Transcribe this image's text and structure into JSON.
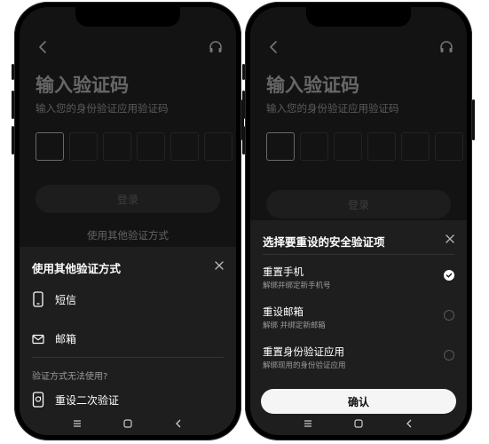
{
  "screen_verify": {
    "title": "输入验证码",
    "subtitle": "输入您的身份验证应用验证码",
    "code_length": 6,
    "login_label": "登录",
    "other_methods_link": "使用其他验证方式",
    "sheet": {
      "title": "使用其他验证方式",
      "options": [
        {
          "label": "短信",
          "icon": "phone-icon"
        },
        {
          "label": "邮箱",
          "icon": "mail-icon"
        }
      ],
      "unavailable_hint": "验证方式无法使用?",
      "reset_label": "重设二次验证",
      "reset_icon": "reset-device-icon"
    }
  },
  "screen_reset": {
    "title": "输入验证码",
    "subtitle": "输入您的身份验证应用验证码",
    "login_label": "登录",
    "sheet": {
      "title": "选择要重设的安全验证项",
      "options": [
        {
          "title": "重置手机",
          "desc": "解绑并绑定新手机号",
          "selected": true
        },
        {
          "title": "重设邮箱",
          "desc": "解绑 并绑定新邮箱",
          "selected": false
        },
        {
          "title": "重置身份验证应用",
          "desc": "解绑现用的身份验证应用",
          "selected": false
        }
      ],
      "confirm_label": "确认"
    }
  },
  "colors": {
    "screen_bg": "#131313",
    "sheet_bg": "#1e1e1e",
    "confirm_bg": "#f5f5f5"
  }
}
